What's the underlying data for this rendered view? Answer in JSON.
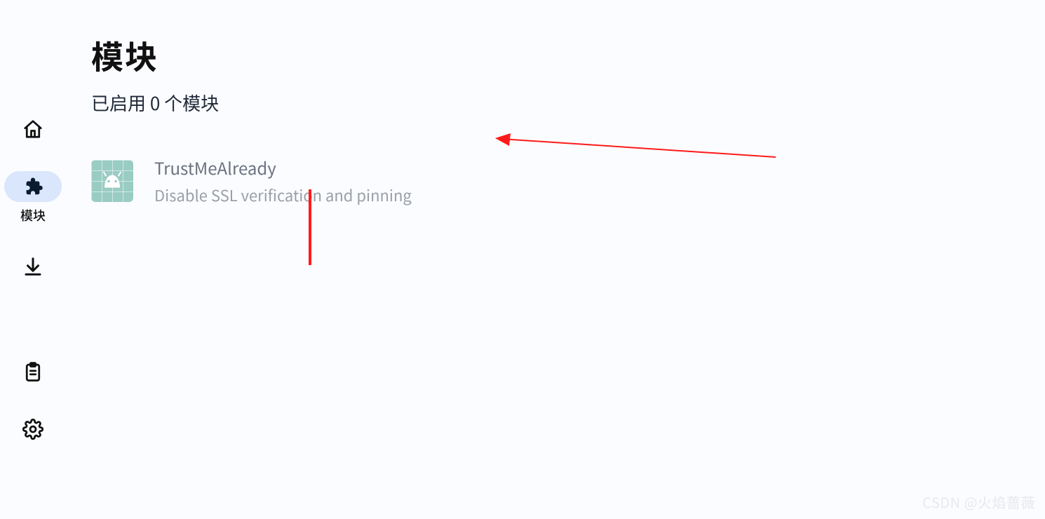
{
  "sidebar": {
    "items": [
      {
        "key": "home",
        "label": ""
      },
      {
        "key": "modules",
        "label": "模块"
      },
      {
        "key": "download",
        "label": ""
      },
      {
        "key": "logs",
        "label": ""
      },
      {
        "key": "settings",
        "label": ""
      }
    ],
    "selected_index": 1
  },
  "header": {
    "title": "模块",
    "subtitle": "已启用 0 个模块"
  },
  "modules": [
    {
      "name": "TrustMeAlready",
      "description": "Disable SSL verification and pinning"
    }
  ],
  "watermark": "CSDN @火焰蔷薇",
  "colors": {
    "selected_nav_pill": "#d9e6fb",
    "icon_tile": "#99ccc3",
    "annotation": "#ff1a1a"
  }
}
